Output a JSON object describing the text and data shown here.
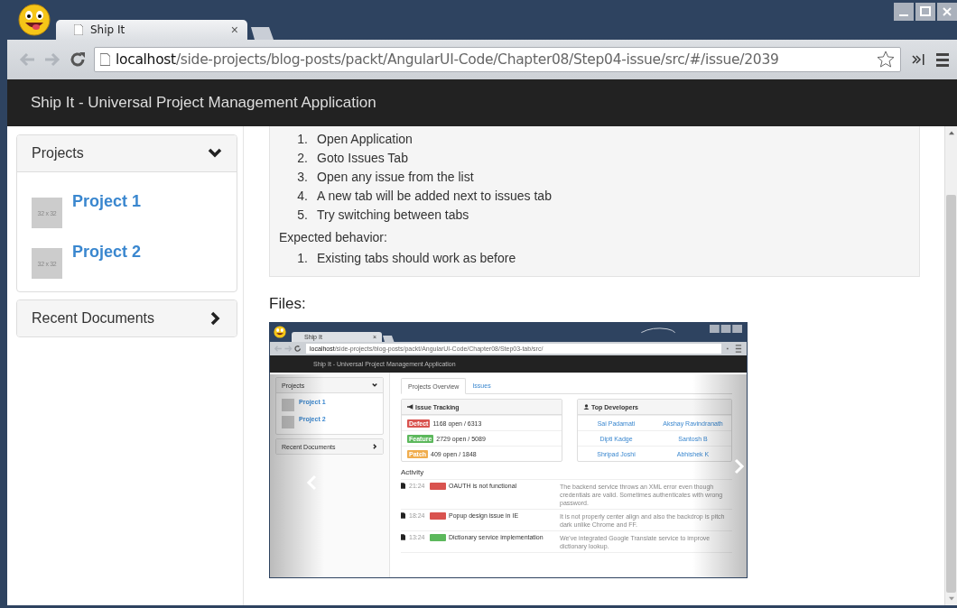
{
  "browser": {
    "tab": {
      "title": "Ship It",
      "close": "×"
    },
    "url": {
      "host": "localhost",
      "path": "/side-projects/blog-posts/packt/AngularUI-Code/Chapter08/Step04-issue/src/#/issue/2039"
    }
  },
  "app": {
    "title": "Ship It - Universal Project Management Application"
  },
  "sidebar": {
    "panels": [
      {
        "title": "Projects",
        "expanded": true,
        "items": [
          {
            "label": "Project 1",
            "thumbnail": "32 x 32"
          },
          {
            "label": "Project 2",
            "thumbnail": "32 x 32"
          }
        ]
      },
      {
        "title": "Recent Documents",
        "expanded": false
      }
    ]
  },
  "issue": {
    "steps": [
      {
        "number": "1.",
        "text": "Open Application"
      },
      {
        "number": "2.",
        "text": "Goto Issues Tab"
      },
      {
        "number": "3.",
        "text": "Open any issue from the list"
      },
      {
        "number": "4.",
        "text": "A new tab will be added next to issues tab"
      },
      {
        "number": "5.",
        "text": "Try switching between tabs"
      }
    ],
    "expected_label": "Expected behavior:",
    "expected": [
      {
        "number": "1.",
        "text": "Existing tabs should work as before"
      }
    ]
  },
  "files": {
    "heading": "Files:",
    "screenshot": {
      "tab_title": "Ship It",
      "close": "×",
      "url_host": "localhost",
      "url_path": "/side-projects/blog-posts/packt/AngularUI-Code/Chapter08/Step03-tab/src/",
      "app_title": "Ship It - Universal Project Management Application",
      "sidebar": {
        "panels": [
          {
            "title": "Projects",
            "expanded": true,
            "items": [
              "Project 1",
              "Project 2"
            ]
          },
          {
            "title": "Recent Documents",
            "expanded": false
          }
        ]
      },
      "tabs": [
        {
          "label": "Projects Overview",
          "selected": true
        },
        {
          "label": "Issues",
          "selected": false
        }
      ],
      "issue_tracking": {
        "title": "Issue Tracking",
        "rows": [
          {
            "tag": "Defect",
            "color": "#d9534f",
            "text": "1168 open / 6313"
          },
          {
            "tag": "Feature",
            "color": "#5cb85c",
            "text": "2729 open / 5089"
          },
          {
            "tag": "Patch",
            "color": "#f0ad4e",
            "text": "409 open / 1848"
          }
        ]
      },
      "top_developers": {
        "title": "Top Developers",
        "names": [
          [
            "Sai Padamati",
            "Akshay Ravindranath"
          ],
          [
            "Dipti Kadge",
            "Santosh B"
          ],
          [
            "Shripad Joshi",
            "Abhishek K"
          ]
        ]
      },
      "activity": {
        "title": "Activity",
        "rows": [
          {
            "time": "21:24",
            "color": "#d9534f",
            "title": "OAUTH is not functional",
            "description": "The backend service throws an XML error even though credentials are valid. Sometimes authenticates with wrong password."
          },
          {
            "time": "18:24",
            "color": "#d9534f",
            "title": "Popup design issue in IE",
            "description": "It is not properly center align and also the backdrop is pitch dark unlike Chrome and FF."
          },
          {
            "time": "13:24",
            "color": "#5cb85c",
            "title": "Dictionary service implementation",
            "description": "We've integrated Google Translate service to improve dictionary lookup."
          }
        ]
      }
    }
  }
}
